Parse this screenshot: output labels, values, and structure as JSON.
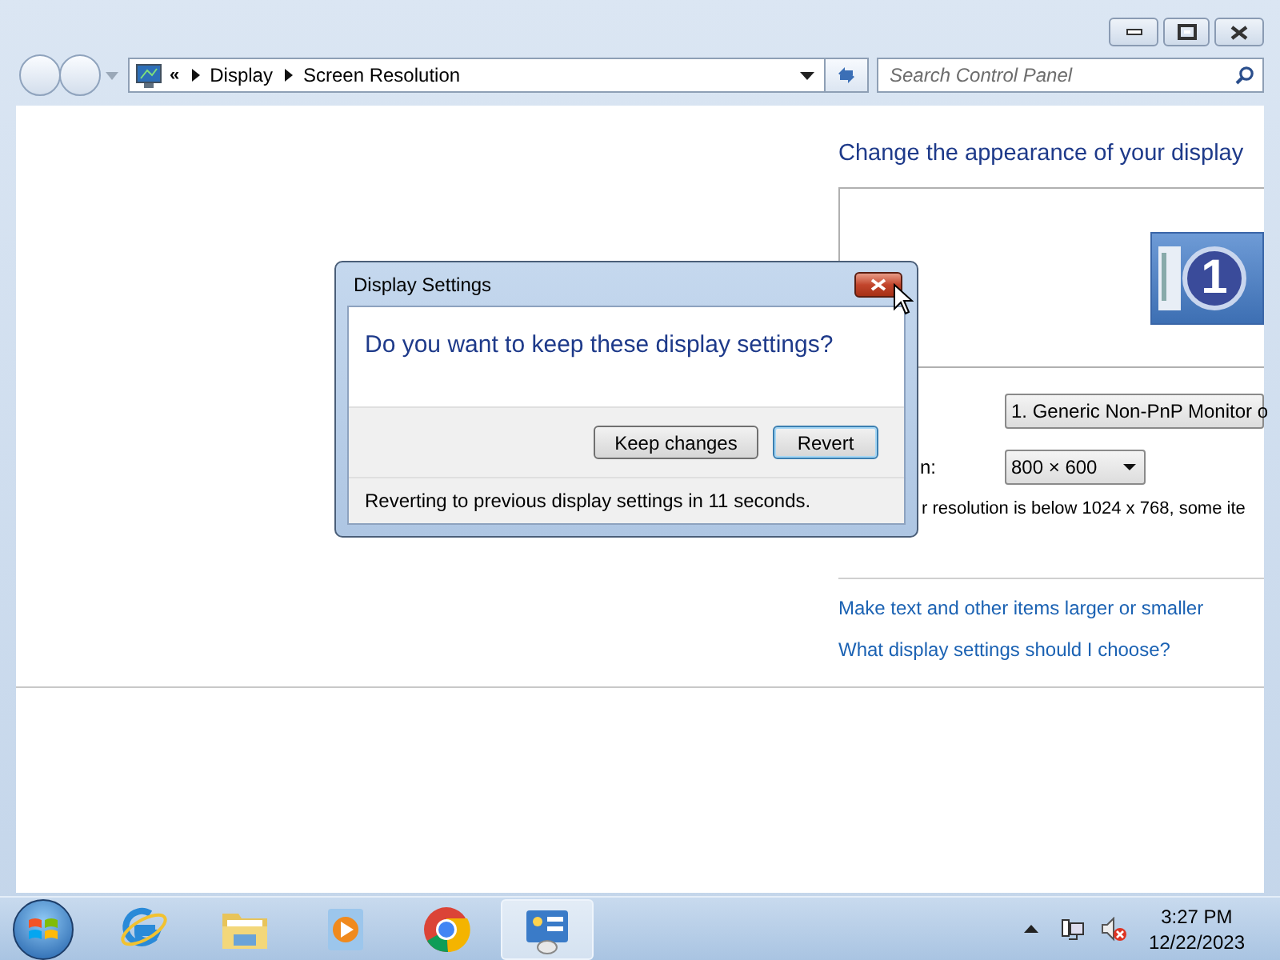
{
  "window": {
    "overflow_chevron": "«",
    "breadcrumb": [
      "Display",
      "Screen Resolution"
    ],
    "search": {
      "placeholder": "Search Control Panel"
    }
  },
  "page": {
    "heading": "Change the appearance of your display",
    "monitor_number": "1",
    "display_select": "1. Generic Non-PnP Monitor o",
    "resolution_label": "n:",
    "resolution_select": "800 × 600",
    "warning": "r resolution is below 1024 x 768, some ite",
    "links": [
      "Make text and other items larger or smaller",
      "What display settings should I choose?"
    ]
  },
  "dialog": {
    "title": "Display Settings",
    "question": "Do you want to keep these display settings?",
    "buttons": [
      {
        "label": "Keep changes",
        "default": false
      },
      {
        "label": "Revert",
        "default": true
      }
    ],
    "countdown": "Reverting to previous display settings in 11 seconds."
  },
  "taskbar": {
    "apps": [
      {
        "kind": "browser-e",
        "active": false
      },
      {
        "kind": "folder",
        "active": false
      },
      {
        "kind": "media",
        "active": false
      },
      {
        "kind": "chrome",
        "active": false
      },
      {
        "kind": "control-panel",
        "active": true
      }
    ],
    "time": "3:27 PM",
    "date": "12/22/2023"
  }
}
